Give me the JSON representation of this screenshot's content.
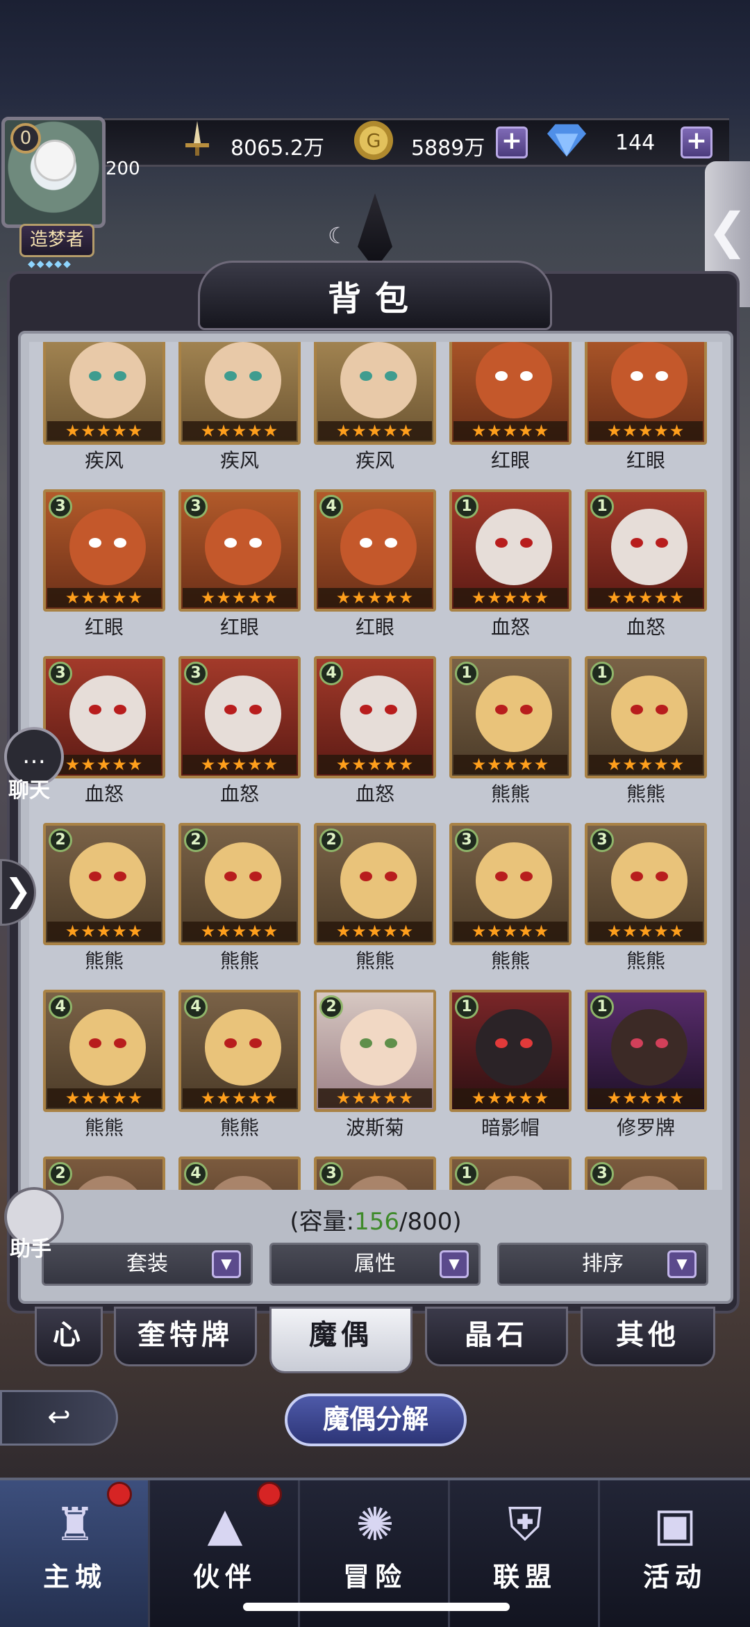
{
  "player": {
    "level": "0",
    "exp": "200",
    "title": "造梦者"
  },
  "resources": {
    "power": "8065.2万",
    "gold": "5889万",
    "diamond": "144"
  },
  "icons": {
    "power": "sword-icon",
    "gold": "gold-coin-icon",
    "diamond": "diamond-icon",
    "plus": "+",
    "side_collapse": "❮",
    "side_expand": "❯",
    "back": "↩"
  },
  "panel": {
    "title": "背包"
  },
  "items": [
    {
      "name": "疾风",
      "level": "",
      "stars": "★★★★★"
    },
    {
      "name": "疾风",
      "level": "",
      "stars": "★★★★★"
    },
    {
      "name": "疾风",
      "level": "",
      "stars": "★★★★★"
    },
    {
      "name": "红眼",
      "level": "",
      "stars": "★★★★★"
    },
    {
      "name": "红眼",
      "level": "",
      "stars": "★★★★★"
    },
    {
      "name": "红眼",
      "level": "3",
      "stars": "★★★★★"
    },
    {
      "name": "红眼",
      "level": "3",
      "stars": "★★★★★"
    },
    {
      "name": "红眼",
      "level": "4",
      "stars": "★★★★★"
    },
    {
      "name": "血怒",
      "level": "1",
      "stars": "★★★★★"
    },
    {
      "name": "血怒",
      "level": "1",
      "stars": "★★★★★"
    },
    {
      "name": "血怒",
      "level": "3",
      "stars": "★★★★★"
    },
    {
      "name": "血怒",
      "level": "3",
      "stars": "★★★★★"
    },
    {
      "name": "血怒",
      "level": "4",
      "stars": "★★★★★"
    },
    {
      "name": "熊熊",
      "level": "1",
      "stars": "★★★★★"
    },
    {
      "name": "熊熊",
      "level": "1",
      "stars": "★★★★★"
    },
    {
      "name": "熊熊",
      "level": "2",
      "stars": "★★★★★"
    },
    {
      "name": "熊熊",
      "level": "2",
      "stars": "★★★★★"
    },
    {
      "name": "熊熊",
      "level": "2",
      "stars": "★★★★★"
    },
    {
      "name": "熊熊",
      "level": "3",
      "stars": "★★★★★"
    },
    {
      "name": "熊熊",
      "level": "3",
      "stars": "★★★★★"
    },
    {
      "name": "熊熊",
      "level": "4",
      "stars": "★★★★★"
    },
    {
      "name": "熊熊",
      "level": "4",
      "stars": "★★★★★"
    },
    {
      "name": "波斯菊",
      "level": "2",
      "stars": "★★★★★"
    },
    {
      "name": "暗影帽",
      "level": "1",
      "stars": "★★★★★"
    },
    {
      "name": "修罗牌",
      "level": "1",
      "stars": "★★★★★"
    },
    {
      "name": "",
      "level": "2",
      "stars": ""
    },
    {
      "name": "",
      "level": "4",
      "stars": ""
    },
    {
      "name": "",
      "level": "3",
      "stars": ""
    },
    {
      "name": "",
      "level": "1",
      "stars": ""
    },
    {
      "name": "",
      "level": "3",
      "stars": ""
    }
  ],
  "capacity": {
    "prefix": "(容量:",
    "used": "156",
    "sep": "/",
    "total": "800",
    "suffix": ")"
  },
  "filters": {
    "set": "套装",
    "attr": "属性",
    "sort": "排序",
    "dropdown_glyph": "▼"
  },
  "tabs": [
    "心",
    "奎特牌",
    "魔偶",
    "晶石",
    "其他"
  ],
  "active_tab": "魔偶",
  "actions": {
    "decompose": "魔偶分解"
  },
  "side": {
    "chat": "聊天",
    "helper": "助手",
    "chat_glyph": "…"
  },
  "nav": [
    {
      "label": "主城",
      "icon": "castle-icon",
      "badge": true
    },
    {
      "label": "伙伴",
      "icon": "witch-hat-icon",
      "badge": true
    },
    {
      "label": "冒险",
      "icon": "magic-orb-icon",
      "badge": false
    },
    {
      "label": "联盟",
      "icon": "shield-icon",
      "badge": false
    },
    {
      "label": "活动",
      "icon": "cards-icon",
      "badge": false
    }
  ],
  "colors": {
    "accent_purple": "#5b4a8c",
    "capacity_green": "#3e8a2a",
    "star_orange": "#ff9f1c",
    "frame_gold": "#a98245",
    "badge_red": "#d62424"
  }
}
